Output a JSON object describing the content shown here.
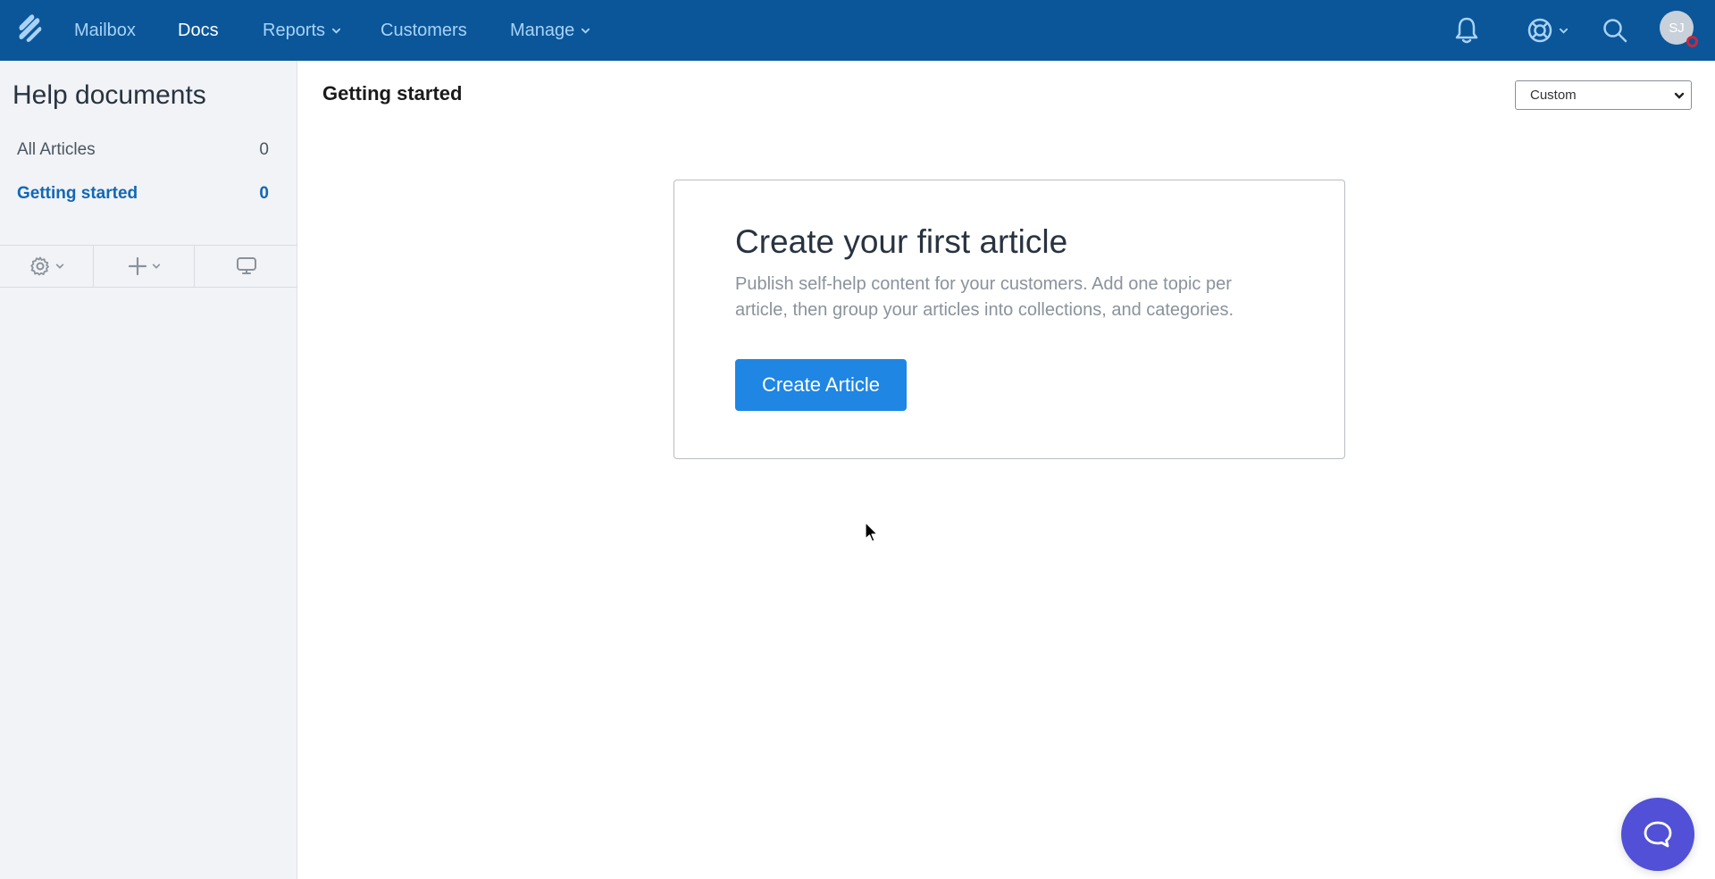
{
  "topnav": {
    "logo_icon": "helpscout-logo-icon",
    "items": [
      {
        "label": "Mailbox",
        "active": false,
        "dropdown": false
      },
      {
        "label": "Docs",
        "active": true,
        "dropdown": false
      },
      {
        "label": "Reports",
        "active": false,
        "dropdown": true
      },
      {
        "label": "Customers",
        "active": false,
        "dropdown": false
      },
      {
        "label": "Manage",
        "active": false,
        "dropdown": true
      }
    ],
    "right_icons": [
      "bell-icon",
      "lifebuoy-icon",
      "search-icon"
    ],
    "avatar_initials": "SJ",
    "status_color": "#c8283e"
  },
  "sidebar": {
    "title": "Help documents",
    "items": [
      {
        "label": "All Articles",
        "count": "0",
        "active": false
      },
      {
        "label": "Getting started",
        "count": "0",
        "active": true
      }
    ],
    "toolbar": [
      "gear-dropdown",
      "add-dropdown",
      "preview-monitor"
    ]
  },
  "main": {
    "title": "Getting started",
    "view_select": {
      "value": "Custom"
    },
    "empty_state": {
      "title": "Create your first article",
      "description": "Publish self-help content for your customers. Add one topic per article, then group your articles into collections, and categories.",
      "button_label": "Create Article"
    }
  },
  "colors": {
    "nav_bg": "#0a5699",
    "nav_text": "#a9d2f7",
    "accent": "#1f86e4",
    "sidebar_active": "#1168b5",
    "chat_fab": "#5150d6"
  }
}
